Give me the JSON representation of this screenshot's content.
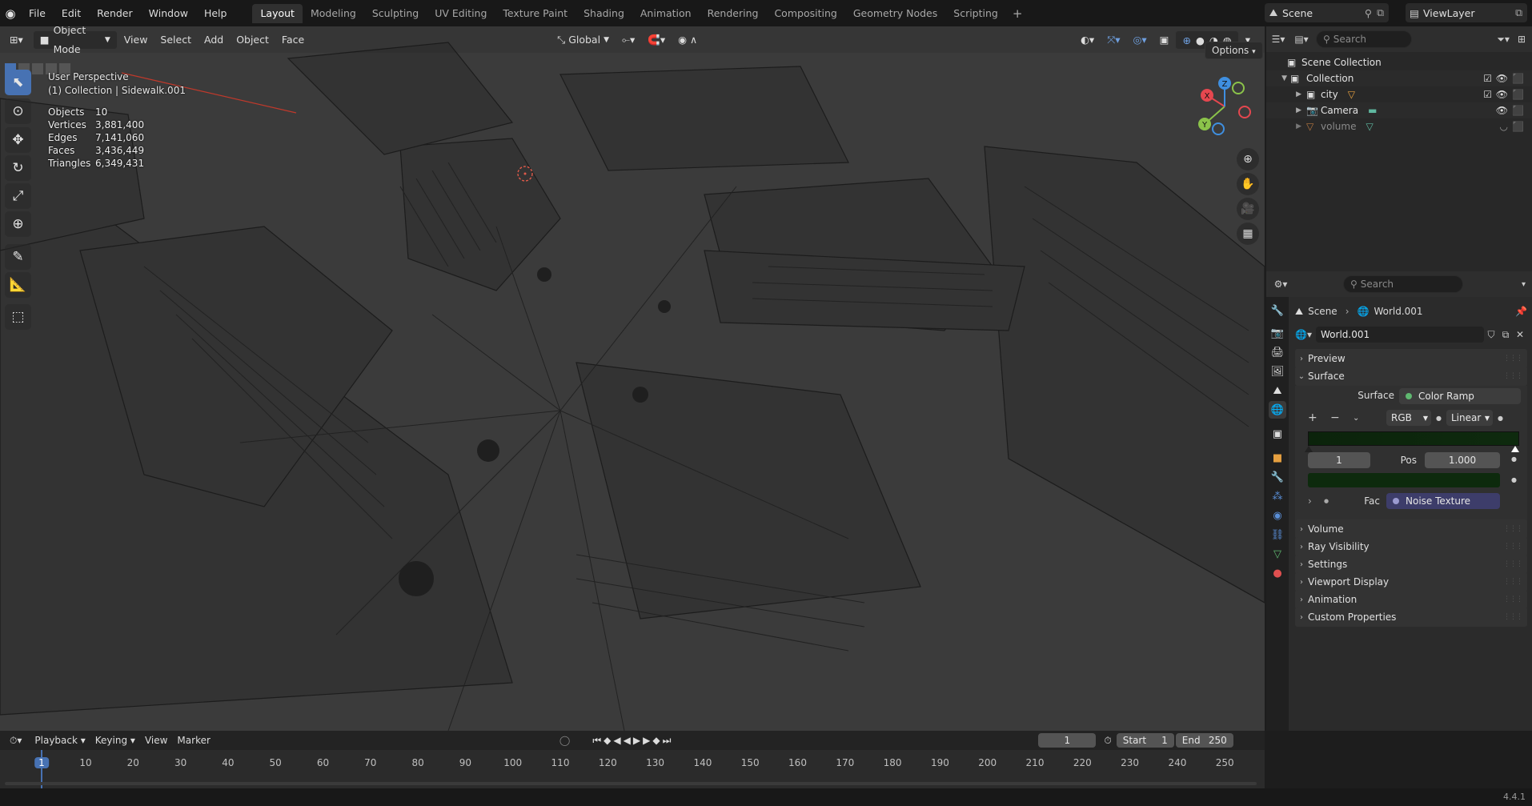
{
  "topbar": {
    "logo_icon": "blender-icon",
    "menus": [
      "File",
      "Edit",
      "Render",
      "Window",
      "Help"
    ],
    "workspaces": [
      "Layout",
      "Modeling",
      "Sculpting",
      "UV Editing",
      "Texture Paint",
      "Shading",
      "Animation",
      "Rendering",
      "Compositing",
      "Geometry Nodes",
      "Scripting"
    ],
    "active_workspace": "Layout",
    "add_symbol": "+",
    "scene_name": "Scene",
    "view_layer": "ViewLayer"
  },
  "viewport": {
    "mode": "Object Mode",
    "menus": [
      "View",
      "Select",
      "Add",
      "Object",
      "Face"
    ],
    "transform_orientation": "Global",
    "options_label": "Options",
    "perspective_label": "User Perspective",
    "collection_label": "(1) Collection | Sidewalk.001",
    "stats": [
      {
        "k": "Objects",
        "v": "10"
      },
      {
        "k": "Vertices",
        "v": "3,881,400"
      },
      {
        "k": "Edges",
        "v": "7,141,060"
      },
      {
        "k": "Faces",
        "v": "3,436,449"
      },
      {
        "k": "Triangles",
        "v": "6,349,431"
      }
    ],
    "gizmo": {
      "x": "X",
      "y": "Y",
      "z": "Z"
    }
  },
  "outliner": {
    "search_placeholder": "Search",
    "root": "Scene Collection",
    "collection": "Collection",
    "items": [
      {
        "name": "city"
      },
      {
        "name": "Camera"
      },
      {
        "name": "volume"
      }
    ]
  },
  "properties": {
    "search_placeholder": "Search",
    "breadcrumb_scene": "Scene",
    "breadcrumb_world": "World.001",
    "world_name": "World.001",
    "sections": {
      "preview": "Preview",
      "surface": "Surface",
      "volume": "Volume",
      "ray_visibility": "Ray Visibility",
      "settings": "Settings",
      "viewport_display": "Viewport Display",
      "animation": "Animation",
      "custom_properties": "Custom Properties"
    },
    "surface_label": "Surface",
    "surface_value": "Color Ramp",
    "ramp_color_mode": "RGB",
    "ramp_interpolation": "Linear",
    "ramp_index": "1",
    "pos_label": "Pos",
    "pos_value": "1.000",
    "fac_label": "Fac",
    "fac_value": "Noise Texture",
    "ramp_color": "#0d2a0d"
  },
  "timeline": {
    "menus": [
      "Playback",
      "Keying",
      "View",
      "Marker"
    ],
    "current_frame": "1",
    "start_label": "Start",
    "start_value": "1",
    "end_label": "End",
    "end_value": "250",
    "ticks": [
      "1",
      "10",
      "20",
      "30",
      "40",
      "50",
      "60",
      "70",
      "80",
      "90",
      "100",
      "110",
      "120",
      "130",
      "140",
      "150",
      "160",
      "170",
      "180",
      "190",
      "200",
      "210",
      "220",
      "230",
      "240",
      "250"
    ]
  },
  "status": {
    "version": "4.4.1"
  },
  "colors": {
    "accent": "#4772b3",
    "active_frame": "#4772b3",
    "x_axis": "#e5474f",
    "y_axis": "#8bc34a",
    "z_axis": "#3f8fe0"
  }
}
